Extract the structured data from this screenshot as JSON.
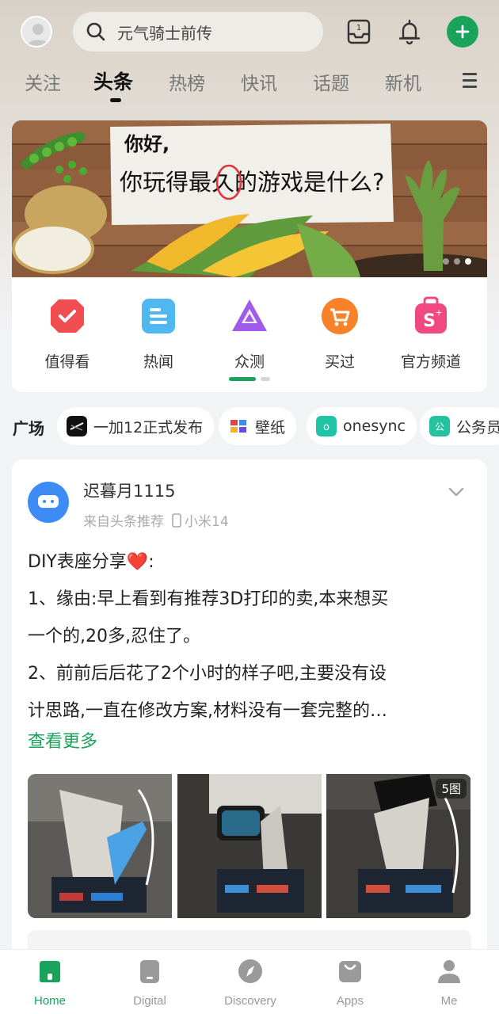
{
  "search": {
    "placeholder": "元气骑士前传"
  },
  "tabs": [
    {
      "label": "关注"
    },
    {
      "label": "头条",
      "active": true
    },
    {
      "label": "热榜"
    },
    {
      "label": "快讯"
    },
    {
      "label": "话题"
    },
    {
      "label": "新机"
    }
  ],
  "banner": {
    "greeting": "你好,",
    "question": "你玩得最久的游戏是什么?",
    "highlight_char": "久",
    "slide_count": 3,
    "active_slide": 3
  },
  "shortcuts": [
    {
      "label": "值得看",
      "icon": "shield-check-icon",
      "color": "#f04e50"
    },
    {
      "label": "热闻",
      "icon": "document-icon",
      "color": "#4fb8f0"
    },
    {
      "label": "众测",
      "icon": "triangle-icon",
      "color": "#a05ce8"
    },
    {
      "label": "买过",
      "icon": "cart-icon",
      "color": "#f7822a"
    },
    {
      "label": "官方频道",
      "icon": "shopping-bag-icon",
      "color": "#f0497f"
    }
  ],
  "plaza": {
    "title": "广场",
    "chips": [
      {
        "label": "一加12正式发布",
        "icon": "oneplus-icon"
      },
      {
        "label": "壁纸",
        "icon": "wallpaper-icon"
      },
      {
        "label": "onesync",
        "icon": "onesync-icon"
      },
      {
        "label": "公务员",
        "icon": "civil-servant-icon"
      }
    ]
  },
  "post": {
    "user": "迟暮月1115",
    "source": "来自头条推荐",
    "device": "小米14",
    "title": "DIY表座分享",
    "heart": "❤️",
    "title_suffix": ":",
    "lines": [
      "1、缘由:早上看到有推荐3D打印的卖,本来想买",
      "一个的,20多,忍住了。",
      "2、前前后后花了2个小时的样子吧,主要没有设",
      "计思路,一直在修改方案,材料没有一套完整的…"
    ],
    "more": "查看更多",
    "image_count": "5图"
  },
  "bottom_nav": [
    {
      "label": "Home",
      "icon": "home-icon",
      "active": true
    },
    {
      "label": "Digital",
      "icon": "digital-icon"
    },
    {
      "label": "Discovery",
      "icon": "compass-icon"
    },
    {
      "label": "Apps",
      "icon": "apps-bag-icon"
    },
    {
      "label": "Me",
      "icon": "person-icon"
    }
  ],
  "colors": {
    "accent": "#1aa35a"
  }
}
